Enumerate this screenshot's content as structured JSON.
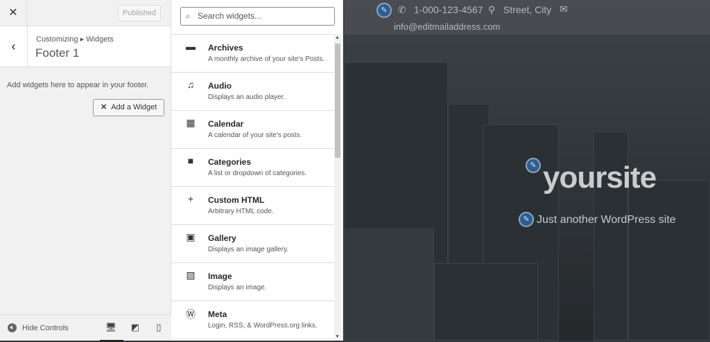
{
  "header": {
    "close_label": "✕",
    "published_label": "Published"
  },
  "section": {
    "breadcrumb": "Customizing ▸ Widgets",
    "title": "Footer 1",
    "description": "Add widgets here to appear in your footer.",
    "add_widget_label": "Add a Widget"
  },
  "footer": {
    "hide_controls_label": "Hide Controls",
    "devices": [
      "desktop",
      "tablet",
      "mobile"
    ]
  },
  "widget_search": {
    "placeholder": "Search widgets..."
  },
  "widgets": [
    {
      "name": "Archives",
      "desc": "A monthly archive of your site's Posts.",
      "icon": "▬"
    },
    {
      "name": "Audio",
      "desc": "Displays an audio player.",
      "icon": "♫"
    },
    {
      "name": "Calendar",
      "desc": "A calendar of your site's posts.",
      "icon": "▦"
    },
    {
      "name": "Categories",
      "desc": "A list or dropdown of categories.",
      "icon": "■"
    },
    {
      "name": "Custom HTML",
      "desc": "Arbitrary HTML code.",
      "icon": "+"
    },
    {
      "name": "Gallery",
      "desc": "Displays an image gallery.",
      "icon": "▣"
    },
    {
      "name": "Image",
      "desc": "Displays an image.",
      "icon": "▨"
    },
    {
      "name": "Meta",
      "desc": "Login, RSS, & WordPress.org links.",
      "icon": "Ⓦ"
    }
  ],
  "preview": {
    "phone": "1-000-123-4567",
    "address": "Street, City",
    "email": "info@editmailaddress.com",
    "site_title": "yoursite",
    "tagline": "Just another WordPress site"
  }
}
